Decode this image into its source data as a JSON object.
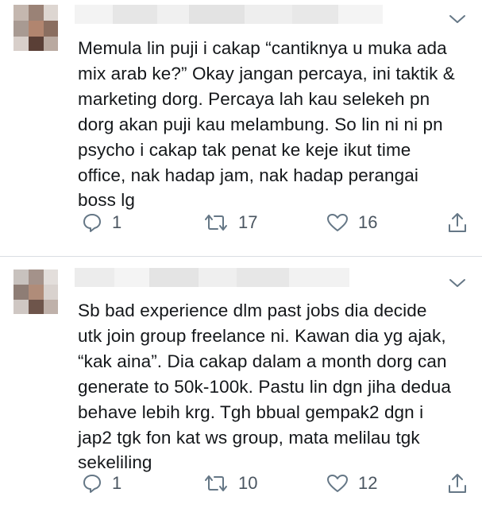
{
  "tweets": [
    {
      "text": "Memula lin puji i cakap “cantiknya u muka ada\nmix arab ke?” Okay jangan percaya, ini taktik &\nmarketing dorg. Percaya lah kau selekeh pn\ndorg akan puji kau melambung. So lin ni ni pn\npsycho i cakap tak penat ke keje ikut time\noffice, nak hadap jam, nak hadap perangai\nboss lg",
      "replies": "1",
      "retweets": "17",
      "likes": "16"
    },
    {
      "text": "Sb bad experience dlm past jobs dia decide\nutk join group freelance ni. Kawan dia yg ajak,\n“kak aina”. Dia cakap dalam a month dorg can\ngenerate to 50k-100k. Pastu lin dgn jiha dedua\nbehave lebih krg. Tgh bbual gempak2 dgn i\njap2 tgk fon kat ws group, mata melilau tgk\nsekeliling",
      "replies": "1",
      "retweets": "10",
      "likes": "12"
    }
  ],
  "icons": {
    "reply": "reply-icon",
    "retweet": "retweet-icon",
    "like": "heart-icon",
    "share": "share-icon",
    "menu": "chevron-down-icon"
  },
  "colors": {
    "text": "#14171a",
    "icon": "#657786",
    "divider": "#d9dee3"
  }
}
